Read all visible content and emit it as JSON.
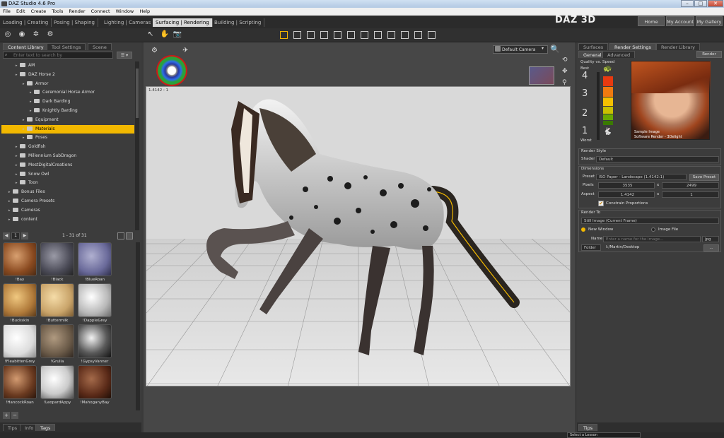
{
  "app": {
    "title": "DAZ Studio 4.6 Pro",
    "logo": "DAZ 3D"
  },
  "menu": [
    "File",
    "Edit",
    "Create",
    "Tools",
    "Render",
    "Connect",
    "Window",
    "Help"
  ],
  "layout_tabs": [
    "Loading | Creating",
    "Posing | Shaping",
    "Lighting | Cameras",
    "Surfacing | Rendering",
    "Building | Scripting"
  ],
  "header_buttons": [
    "Home",
    "My Account",
    "My Gallery"
  ],
  "left_panel": {
    "tabs": [
      "Content Library",
      "Tool Settings",
      "Scene"
    ],
    "search_placeholder": "Enter text to search by",
    "tree": [
      {
        "label": "AM",
        "depth": 1
      },
      {
        "label": "DAZ Horse 2",
        "depth": 1
      },
      {
        "label": "Armor",
        "depth": 2
      },
      {
        "label": "Ceremonial Horse Armor",
        "depth": 3
      },
      {
        "label": "Dark Barding",
        "depth": 3
      },
      {
        "label": "Knightly Barding",
        "depth": 3
      },
      {
        "label": "Equipment",
        "depth": 2
      },
      {
        "label": "Materials",
        "depth": 2,
        "selected": true
      },
      {
        "label": "Poses",
        "depth": 2
      },
      {
        "label": "Goldfish",
        "depth": 1
      },
      {
        "label": "Millennium SubDragon",
        "depth": 1
      },
      {
        "label": "MostDigitalCreations",
        "depth": 1
      },
      {
        "label": "Snow Owl",
        "depth": 1
      },
      {
        "label": "Toon",
        "depth": 1
      },
      {
        "label": "Bonus Files",
        "depth": 0
      },
      {
        "label": "Camera Presets",
        "depth": 0
      },
      {
        "label": "Cameras",
        "depth": 0
      },
      {
        "label": "content",
        "depth": 0
      }
    ],
    "pager": {
      "page": "1",
      "range": "1 - 31 of 31"
    },
    "thumbnails": [
      "!Bay",
      "!Black",
      "!BlueRoan",
      "!Buckskin",
      "!Buttermilk",
      "!DappleGrey",
      "!FleabittenGrey",
      "!Grulla",
      "!GypsyVanner",
      "!HancockRoan",
      "!LeopardAppy",
      "!MahoganyBay"
    ],
    "bottom_tabs": [
      "Tips",
      "Info",
      "Tags"
    ]
  },
  "viewport": {
    "camera": "Default Camera",
    "aspect_label": "1.4142 : 1"
  },
  "right_panel": {
    "tabs": [
      "Surfaces",
      "Render Settings",
      "Render Library"
    ],
    "subtabs": [
      "General",
      "Advanced"
    ],
    "render_button": "Render",
    "quality": {
      "title": "Quality vs. Speed",
      "best": "Best",
      "worst": "Worst",
      "levels": [
        "4",
        "3",
        "2",
        "1"
      ]
    },
    "sample": {
      "line1": "Sample Image",
      "line2": "Software Render - 3Delight"
    },
    "render_style": {
      "title": "Render Style",
      "shader_label": "Shader",
      "shader_value": "Default"
    },
    "dimensions": {
      "title": "Dimensions",
      "preset_label": "Preset",
      "preset_value": "ISO Paper - Landscape (1.4142:1)",
      "save_preset": "Save Preset",
      "pixels_label": "Pixels",
      "width": "3535",
      "x": "x",
      "height": "2499",
      "aspect_label": "Aspect",
      "aspect_w": "1.4142",
      "aspect_h": "1",
      "constrain": "Constrain Proportions"
    },
    "render_to": {
      "title": "Render To",
      "target": "Still Image (Current Frame)",
      "new_window": "New Window",
      "image_file": "Image File",
      "name_label": "Name",
      "name_placeholder": "Enter a name for the image...",
      "format": "jpg",
      "folder_label": "Folder",
      "folder_value": "I:/Martin/Desktop"
    },
    "tips_tab": "Tips",
    "lesson": "Select a Lesson"
  },
  "colors": {
    "accent": "#f2b800",
    "panel": "#3c3c3c",
    "viewport_bg": "#d9d9d9"
  }
}
